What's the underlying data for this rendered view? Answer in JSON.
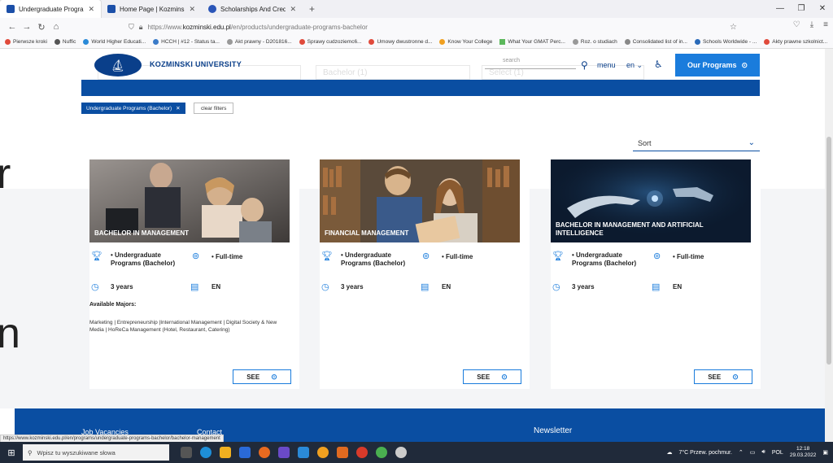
{
  "tabs": [
    {
      "label": "Undergraduate Programs (Bach",
      "active": true
    },
    {
      "label": "Home Page | Kozminski Unive",
      "active": false
    },
    {
      "label": "Scholarships And Credits",
      "active": false
    }
  ],
  "url": {
    "prefix": "https://www.",
    "domain": "kozminski.edu.pl",
    "path": "/en/products/undergraduate-programs-bachelor"
  },
  "bookmarks": [
    "Pierwsze kroki",
    "Nuffic",
    "World Higher Educati...",
    "HCCH | #12 - Status ta...",
    "Akt prawny - D201816...",
    "Sprawy cudzoziemc6...",
    "Umowy dwustronne d...",
    "Know Your College",
    "What Your GMAT Perc...",
    "Roz. o studiach",
    "Consolidated list of in...",
    "Schools Worldwide - ...",
    "Akty prawne szkolnict..."
  ],
  "header": {
    "brand": "KOZMINSKI UNIVERSITY",
    "search_placeholder": "search",
    "menu": "menu",
    "lang": "en",
    "programs_button": "Our Programs",
    "ghost_field_1": "Bachelor (1)",
    "ghost_field_2": "Select (1)"
  },
  "filters": {
    "active_chip": "Undergraduate Programs (Bachelor)",
    "clear": "clear filters"
  },
  "sort": {
    "label": "Sort"
  },
  "bg_letters": [
    "r",
    "n"
  ],
  "cards": [
    {
      "title": "BACHELOR IN MANAGEMENT",
      "level": "• Undergraduate Programs (Bachelor)",
      "mode": "• Full-time",
      "duration": "3 years",
      "language": "EN",
      "majors_heading": "Available Majors:",
      "majors": "Marketing | Entrepreneurship |International Management | Digital Society & New Media | HoReCa Management (Hotel, Restaurant, Catering)",
      "button": "SEE"
    },
    {
      "title": "FINANCIAL MANAGEMENT",
      "level": "• Undergraduate Programs (Bachelor)",
      "mode": "• Full-time",
      "duration": "3 years",
      "language": "EN",
      "button": "SEE"
    },
    {
      "title": "BACHELOR IN MANAGEMENT AND ARTIFICIAL INTELLIGENCE",
      "level": "• Undergraduate Programs (Bachelor)",
      "mode": "• Full-time",
      "duration": "3 years",
      "language": "EN",
      "button": "SEE"
    }
  ],
  "footer": {
    "col1": "Job Vacancies",
    "col2": "Contact",
    "newsletter": "Newsletter"
  },
  "status_url": "https://www.kozminski.edu.pl/en/programs/undergraduate-programs-bachelor/bachelor-management",
  "taskbar": {
    "search_placeholder": "Wpisz tu wyszukiwane słowa",
    "weather": "7°C Przew. pochmur.",
    "lang": "POL",
    "time": "12:18",
    "date": "29.03.2022"
  }
}
